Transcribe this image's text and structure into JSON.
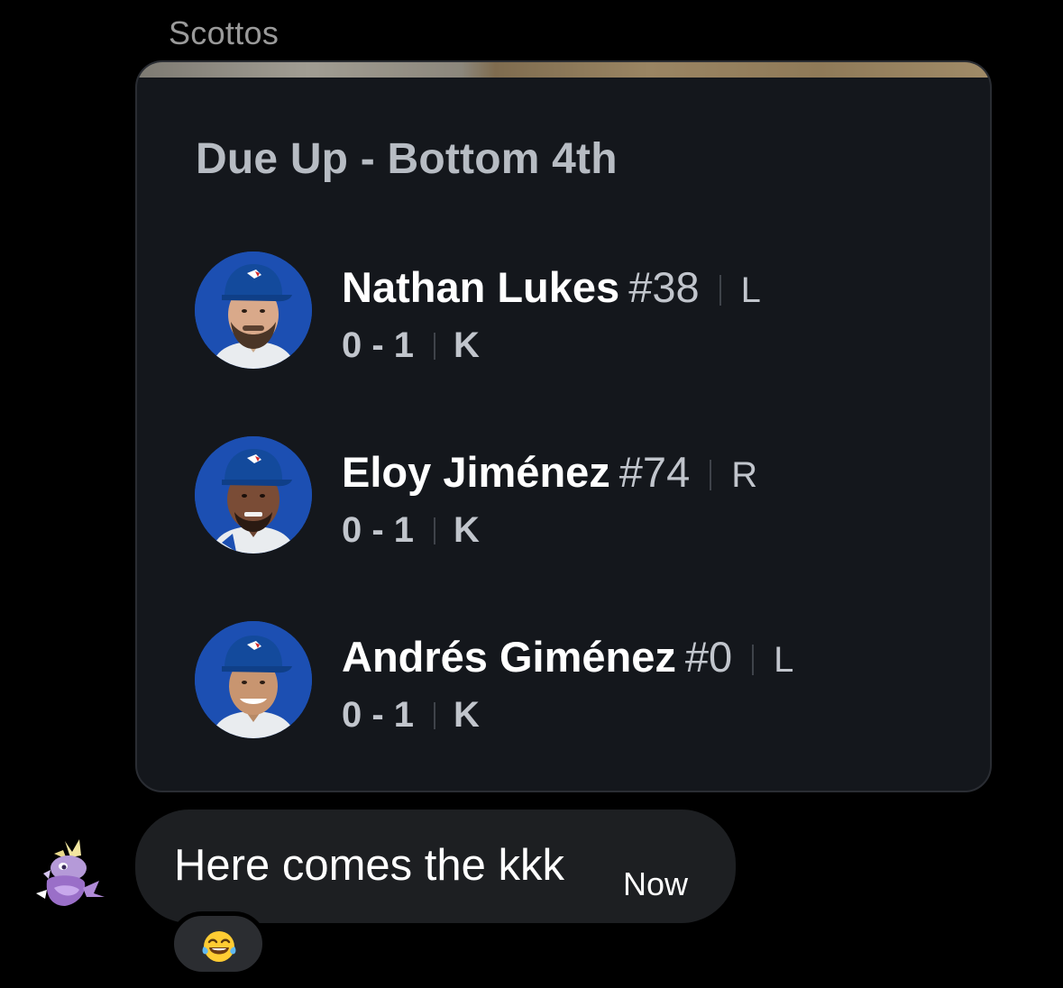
{
  "conversation": {
    "sender_name": "Scottos"
  },
  "card": {
    "title": "Due Up - Bottom 4th",
    "players": [
      {
        "name": "Nathan Lukes",
        "number": "#38",
        "hand": "L",
        "stat": "0 - 1",
        "result": "K"
      },
      {
        "name": "Eloy Jiménez",
        "number": "#74",
        "hand": "R",
        "stat": "0 - 1",
        "result": "K"
      },
      {
        "name": "Andrés Giménez",
        "number": "#0",
        "hand": "L",
        "stat": "0 - 1",
        "result": "K"
      }
    ]
  },
  "message": {
    "text": "Here comes the kkk",
    "time": "Now",
    "reaction_icon": "tears-of-joy-emoji-icon"
  },
  "colors": {
    "background": "#000000",
    "card_background": "#14171c",
    "bubble_background": "#1d1f22",
    "avatar_blue": "#1c4fb2",
    "muted_text": "#c1c5cc"
  }
}
